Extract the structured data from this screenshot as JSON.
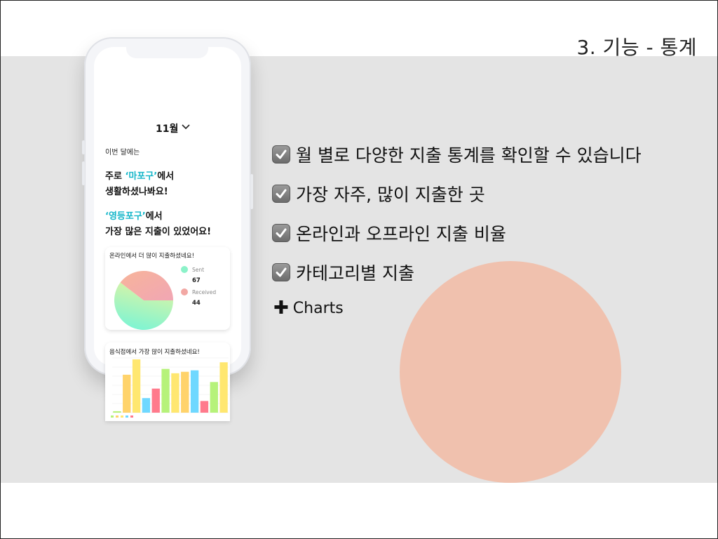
{
  "slide": {
    "title": "3. 기능 - 통계"
  },
  "colors": {
    "band": "#e4e4e4",
    "circle": "#f0c1ae",
    "highlight": "#14b6c9"
  },
  "app": {
    "month": "11월",
    "month_icon": "chevron-down-icon",
    "intro": "이번 달에는",
    "msg1_prefix": "주로 ",
    "msg1_highlight": "‘마포구’",
    "msg1_suffix": "에서",
    "msg1_line2": "생활하셨나봐요!",
    "msg2_highlight": "‘영등포구’",
    "msg2_suffix": "에서",
    "msg2_line2": "가장 많은 지출이 있었어요!"
  },
  "features": [
    {
      "icon": "checkbox-checked-icon",
      "text": "월 별로 다양한 지출 통계를 확인할 수 있습니다"
    },
    {
      "icon": "checkbox-checked-icon",
      "text": "가장 자주, 많이 지출한 곳"
    },
    {
      "icon": "checkbox-checked-icon",
      "text": "온라인과 오프라인 지출 비율"
    },
    {
      "icon": "checkbox-checked-icon",
      "text": "카테고리별 지출"
    }
  ],
  "plus_item": {
    "icon": "plus-icon",
    "text": "Charts"
  },
  "chart_data": [
    {
      "type": "pie",
      "title": "온라인에서 더 많이 지출하셨네요!",
      "series": [
        {
          "name": "Sent",
          "value": 67,
          "color": "#7ff3d2"
        },
        {
          "name": "Received",
          "value": 44,
          "color": "#f6a9a4"
        }
      ],
      "legend": "right"
    },
    {
      "type": "bar",
      "title": "음식점에서 가장 많이 지출하셨네요!",
      "values": [
        2,
        52,
        73,
        20,
        33,
        60,
        54,
        56,
        58,
        16,
        42,
        69
      ],
      "colors": [
        "#b6f27a",
        "#ffd36b",
        "#ffe770",
        "#6fd8ff",
        "#ff7a8c",
        "#b6f27a",
        "#ffe770",
        "#ffd36b",
        "#6fd8ff",
        "#ff7a8c",
        "#b6f27a",
        "#ffe770"
      ],
      "grid": true
    }
  ]
}
